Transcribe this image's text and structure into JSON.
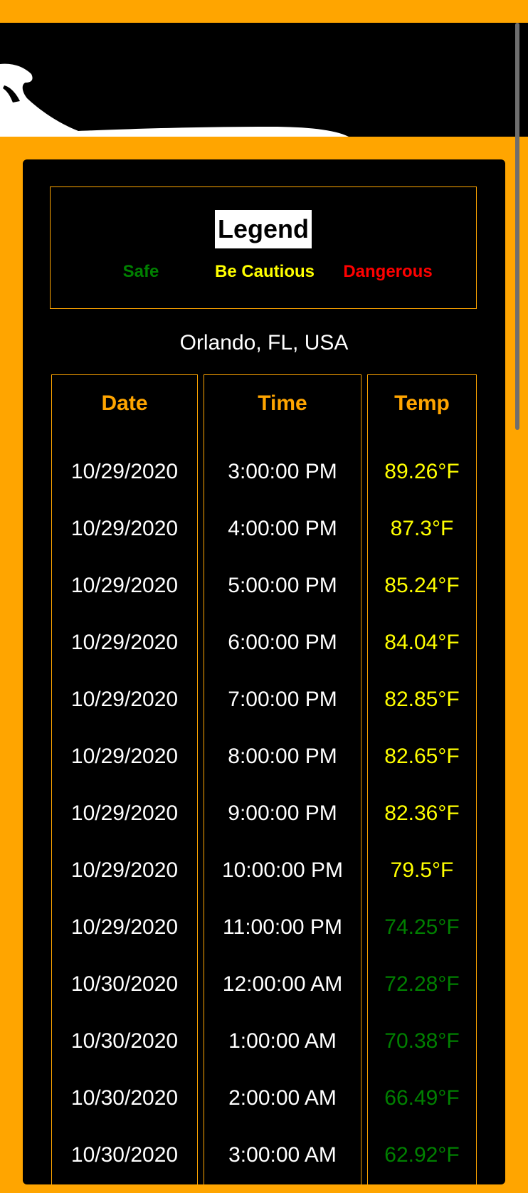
{
  "legend": {
    "title": "Legend",
    "items": [
      {
        "label": "Safe",
        "color": "#008000"
      },
      {
        "label": "Be Cautious",
        "color": "#FFFF00"
      },
      {
        "label": "Dangerous",
        "color": "#FF0000"
      }
    ]
  },
  "location": "Orlando, FL, USA",
  "table": {
    "headers": [
      "Date",
      "Time",
      "Temp"
    ],
    "rows": [
      {
        "date": "10/29/2020",
        "time": "3:00:00 PM",
        "temp": "89.26°F",
        "status": "caution"
      },
      {
        "date": "10/29/2020",
        "time": "4:00:00 PM",
        "temp": "87.3°F",
        "status": "caution"
      },
      {
        "date": "10/29/2020",
        "time": "5:00:00 PM",
        "temp": "85.24°F",
        "status": "caution"
      },
      {
        "date": "10/29/2020",
        "time": "6:00:00 PM",
        "temp": "84.04°F",
        "status": "caution"
      },
      {
        "date": "10/29/2020",
        "time": "7:00:00 PM",
        "temp": "82.85°F",
        "status": "caution"
      },
      {
        "date": "10/29/2020",
        "time": "8:00:00 PM",
        "temp": "82.65°F",
        "status": "caution"
      },
      {
        "date": "10/29/2020",
        "time": "9:00:00 PM",
        "temp": "82.36°F",
        "status": "caution"
      },
      {
        "date": "10/29/2020",
        "time": "10:00:00 PM",
        "temp": "79.5°F",
        "status": "caution"
      },
      {
        "date": "10/29/2020",
        "time": "11:00:00 PM",
        "temp": "74.25°F",
        "status": "safe"
      },
      {
        "date": "10/30/2020",
        "time": "12:00:00 AM",
        "temp": "72.28°F",
        "status": "safe"
      },
      {
        "date": "10/30/2020",
        "time": "1:00:00 AM",
        "temp": "70.38°F",
        "status": "safe"
      },
      {
        "date": "10/30/2020",
        "time": "2:00:00 AM",
        "temp": "66.49°F",
        "status": "safe"
      },
      {
        "date": "10/30/2020",
        "time": "3:00:00 AM",
        "temp": "62.92°F",
        "status": "safe"
      }
    ]
  },
  "colors": {
    "accent": "#FFA500",
    "safe": "#008000",
    "caution": "#FFFF00",
    "danger": "#FF0000"
  }
}
